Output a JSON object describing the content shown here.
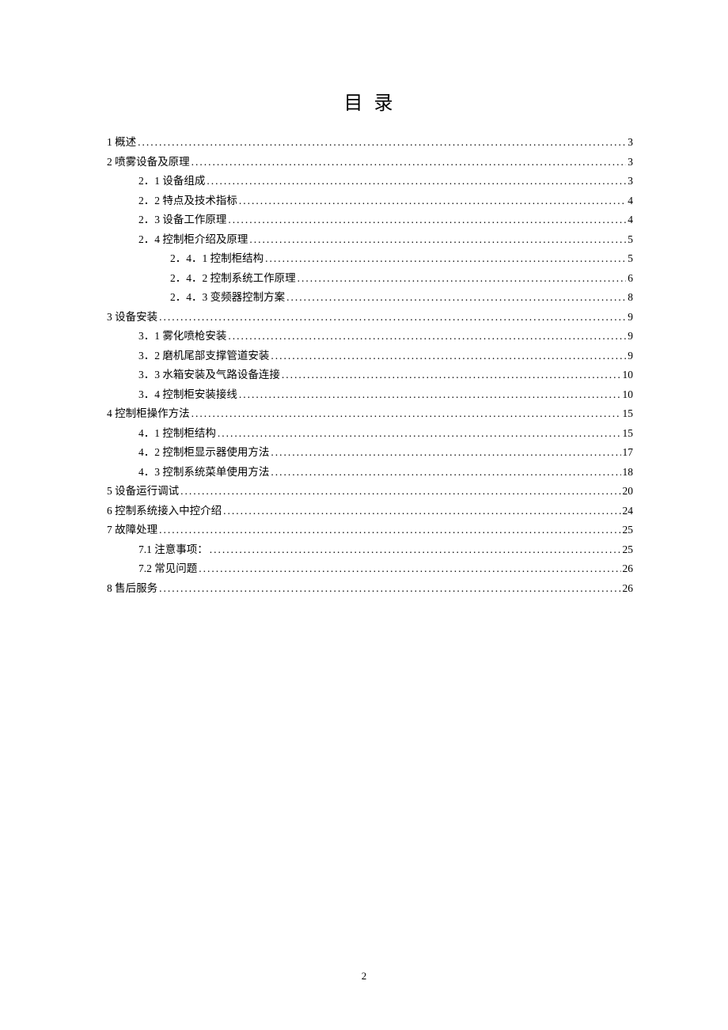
{
  "title": "目 录",
  "page_number": "2",
  "toc": [
    {
      "level": 0,
      "label": "1 概述",
      "page": "3"
    },
    {
      "level": 0,
      "label": "2 喷雾设备及原理",
      "page": "3"
    },
    {
      "level": 1,
      "label": "2．1 设备组成",
      "page": "3"
    },
    {
      "level": 1,
      "label": "2．2 特点及技术指标",
      "page": "4"
    },
    {
      "level": 1,
      "label": "2．3 设备工作原理",
      "page": "4"
    },
    {
      "level": 1,
      "label": "2．4 控制柜介绍及原理",
      "page": "5"
    },
    {
      "level": 2,
      "label": "2．4．1 控制柜结构",
      "page": "5"
    },
    {
      "level": 2,
      "label": "2．4．2 控制系统工作原理",
      "page": "6"
    },
    {
      "level": 2,
      "label": "2．4．3 变频器控制方案",
      "page": "8"
    },
    {
      "level": 0,
      "label": "3 设备安装",
      "page": "9"
    },
    {
      "level": 1,
      "label": "3．1  雾化喷枪安装",
      "page": "9"
    },
    {
      "level": 1,
      "label": "3．2  磨机尾部支撑管道安装",
      "page": "9"
    },
    {
      "level": 1,
      "label": "3．3  水箱安装及气路设备连接",
      "page": "10"
    },
    {
      "level": 1,
      "label": "3．4 控制柜安装接线",
      "page": "10"
    },
    {
      "level": 0,
      "label": "4 控制柜操作方法",
      "page": "15"
    },
    {
      "level": 1,
      "label": "4．1 控制柜结构",
      "page": "15"
    },
    {
      "level": 1,
      "label": "4．2 控制柜显示器使用方法",
      "page": "17"
    },
    {
      "level": 1,
      "label": "4．3 控制系统菜单使用方法",
      "page": "18"
    },
    {
      "level": 0,
      "label": "5  设备运行调试",
      "page": "20"
    },
    {
      "level": 0,
      "label": "6  控制系统接入中控介绍",
      "page": "24"
    },
    {
      "level": 0,
      "label": "7  故障处理",
      "page": "25"
    },
    {
      "level": 1,
      "label": "7.1 注意事项：",
      "page": "25"
    },
    {
      "level": 1,
      "label": "7.2  常见问题",
      "page": "26"
    },
    {
      "level": 0,
      "label": "8 售后服务",
      "page": "26"
    }
  ]
}
